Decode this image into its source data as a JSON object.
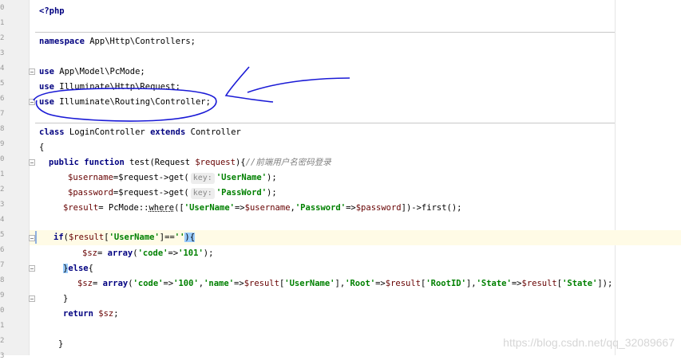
{
  "editor": {
    "gutter_numbers": [
      "0",
      "1",
      "2",
      "3",
      "4",
      "5",
      "6",
      "7",
      "8",
      "9",
      "0",
      "1",
      "2",
      "3",
      "4",
      "5",
      "6",
      "7",
      "8",
      "9",
      "0",
      "1",
      "2",
      "3"
    ],
    "code": {
      "php_open": "<?php",
      "namespace_kw": "namespace",
      "namespace_rest": " App\\Http\\Controllers;",
      "use_kw": "use",
      "use1": " App\\Model\\PcMode;",
      "use2": " Illuminate\\Http\\Request;",
      "use3": " Illuminate\\Routing\\Controller;",
      "class_kw": "class",
      "class_name": " LoginController ",
      "extends_kw": "extends",
      "class_parent": " Controller",
      "open_brace": "{",
      "public_kw": "public",
      "function_kw": " function",
      "fn_sig": " test(Request ",
      "request_var": "$request",
      "fn_sig_end": "){",
      "fn_comment": "//前端用户名密码登录",
      "username_var": "$username",
      "eq_request": "=$request->get(",
      "hint_key": "key:",
      "str_username": "'UserName'",
      "close_paren_semi": ");",
      "password_var": "$password",
      "str_password": "'PassWord'",
      "result_var": "$result",
      "result_eq": "= PcMode::",
      "where_fn": "where",
      "where_open": "([",
      "str_username2": "'UserName'",
      "arrow": "=>",
      "username_var2": "$username",
      "comma": ",",
      "str_password2": "'Password'",
      "password_var2": "$password",
      "where_close": "])->first();",
      "if_kw": "if",
      "if_open": "(",
      "result_var2": "$result",
      "bracket_open": "[",
      "str_username3": "'UserName'",
      "eq_empty": "]==",
      "str_empty": "''",
      "if_close": "){",
      "sz_var": "$sz",
      "sz_eq": "= ",
      "array_kw": "array",
      "str_code": "'code'",
      "str_101": "'101'",
      "else_open": "}",
      "else_kw": "else",
      "else_brace": "{",
      "sz_var2": "$sz",
      "array_kw2": "array",
      "str_code2": "'code'",
      "str_100": "'100'",
      "str_name": "'name'",
      "result_var3": "$result",
      "str_username4": "'UserName'",
      "bracket_close": "],",
      "str_root": "'Root'",
      "result_var4": "$result",
      "str_rootid": "'RootID'",
      "str_state": "'State'",
      "result_var5": "$result",
      "str_state2": "'State'",
      "end_paren": "]);",
      "close_brace": "}",
      "return_kw": "return",
      "return_var": " $sz",
      "semi": ";"
    }
  },
  "watermark": "https://blog.csdn.net/qq_32089667",
  "colors": {
    "annotation_ink": "#1a1ad6",
    "keyword": "#000080",
    "string": "#008000",
    "variable": "#660000"
  }
}
